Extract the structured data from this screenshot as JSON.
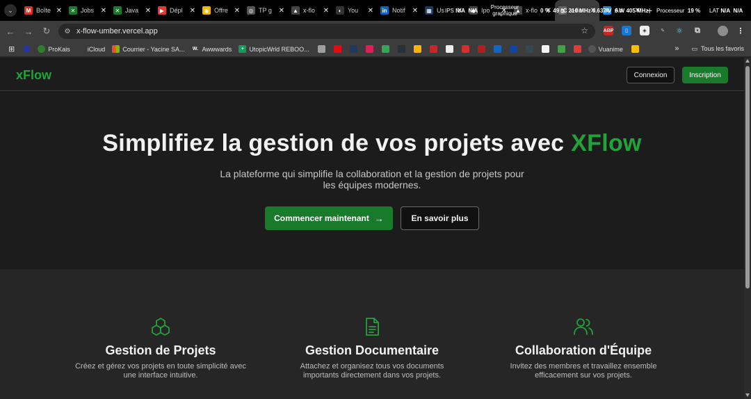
{
  "browser": {
    "tabs": [
      {
        "label": "Boîte",
        "color": "#d93025",
        "glyph": "M"
      },
      {
        "label": "Jobs",
        "color": "#1a7a2b",
        "glyph": "✕"
      },
      {
        "label": "Java",
        "color": "#1a7a2b",
        "glyph": "✕"
      },
      {
        "label": "Dépl",
        "color": "#e53935",
        "glyph": "▶"
      },
      {
        "label": "Offre",
        "color": "#f4b400",
        "glyph": "◉"
      },
      {
        "label": "TP g",
        "color": "#555555",
        "glyph": "◎"
      },
      {
        "label": "x-flo",
        "color": "#444444",
        "glyph": "▲"
      },
      {
        "label": "You",
        "color": "#333333",
        "glyph": "◐"
      },
      {
        "label": "Notif",
        "color": "#0a66c2",
        "glyph": "in"
      },
      {
        "label": "Us",
        "color": "#1e3a5f",
        "glyph": "▦"
      },
      {
        "label": "Ipo",
        "color": "#444444",
        "glyph": "◆"
      },
      {
        "label": "x-flo",
        "color": "#444444",
        "glyph": "▲"
      },
      {
        "label": "x-flo",
        "color": "#666666",
        "glyph": "◍"
      },
      {
        "label": "Ab",
        "color": "#1e88e5",
        "glyph": "A"
      }
    ],
    "active_tab_index": 12,
    "system_monitor": {
      "ips_label": "IPS",
      "ips_value_1": "N/A",
      "ips_value_2": "N/A",
      "gpu_label": "Processeur graphique",
      "gpu_percent": "0 %",
      "gpu_temp": "49 °C",
      "gpu_clock": "210 MHz",
      "gpu_voltage": "0.637 V",
      "gpu_power": "6 W",
      "gpu_mem_clock": "405 MHz",
      "cpu_label": "Processeur",
      "cpu_percent": "19 %",
      "lat_label": "LAT",
      "lat_value_1": "N/A",
      "lat_value_2": "N/A"
    },
    "url": "x-flow-umber.vercel.app",
    "bookmarks": [
      {
        "label": "ProKais",
        "color": "#2e7d32"
      },
      {
        "label": "iCloud",
        "color": "#777777"
      },
      {
        "label": "Courrier - Yacine SA...",
        "color": "#f25022"
      },
      {
        "label": "Awwwards",
        "color": "#333333"
      },
      {
        "label": "UtopicWrld REBOO...",
        "color": "#0f9d58"
      },
      {
        "label": "Vuanime",
        "color": "#555555"
      }
    ],
    "bookmarks_folder": "Tous les favoris"
  },
  "site": {
    "logo": "xFlow",
    "nav": {
      "login": "Connexion",
      "signup": "Inscription"
    },
    "hero": {
      "title_prefix": "Simplifiez la gestion de vos projets avec",
      "title_accent": "XFlow",
      "subtitle": "La plateforme qui simplifie la collaboration et la gestion de projets pour les équipes modernes.",
      "cta_primary": "Commencer maintenant",
      "cta_secondary": "En savoir plus"
    },
    "features": [
      {
        "icon": "cubes-icon",
        "title": "Gestion de Projets",
        "description": "Créez et gérez vos projets en toute simplicité avec une interface intuitive."
      },
      {
        "icon": "document-icon",
        "title": "Gestion Documentaire",
        "description": "Attachez et organisez tous vos documents importants directement dans vos projets."
      },
      {
        "icon": "users-icon",
        "title": "Collaboration d'Équipe",
        "description": "Invitez des membres et travaillez ensemble efficacement sur vos projets."
      }
    ],
    "colors": {
      "accent": "#22a33a",
      "button_green": "#1a7a2b",
      "background": "#1c1c1c",
      "features_bg": "#262626"
    }
  }
}
